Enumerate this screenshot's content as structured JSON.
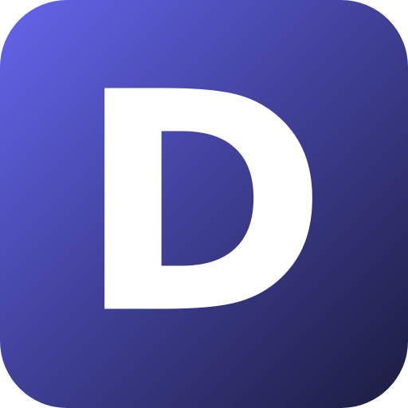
{
  "icon": {
    "letter": "D",
    "colors": {
      "gradient_start": "#6466ec",
      "gradient_mid": "#3f3f96",
      "gradient_end": "#1c1c3f",
      "letter": "#ffffff"
    }
  }
}
